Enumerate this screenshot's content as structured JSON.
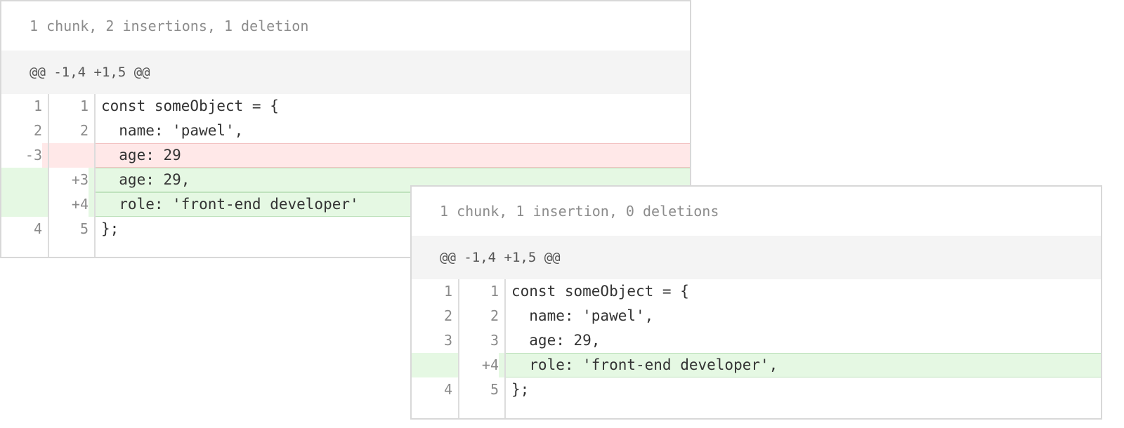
{
  "panels": [
    {
      "summary": "1 chunk, 2 insertions, 1 deletion",
      "hunk_header": "@@ -1,4 +1,5 @@",
      "lines": [
        {
          "type": "ctx",
          "old": "1",
          "new": "1",
          "code": "const someObject = {"
        },
        {
          "type": "ctx",
          "old": "2",
          "new": "2",
          "code": "  name: 'pawel',"
        },
        {
          "type": "del",
          "old": "-3",
          "new": "",
          "code": "  age: 29"
        },
        {
          "type": "add",
          "old": "",
          "new": "+3",
          "code": "  age: 29,"
        },
        {
          "type": "add",
          "old": "",
          "new": "+4",
          "code": "  role: 'front-end developer'"
        },
        {
          "type": "ctx",
          "old": "4",
          "new": "5",
          "code": "};"
        }
      ]
    },
    {
      "summary": "1 chunk, 1 insertion, 0 deletions",
      "hunk_header": "@@ -1,4 +1,5 @@",
      "lines": [
        {
          "type": "ctx",
          "old": "1",
          "new": "1",
          "code": "const someObject = {"
        },
        {
          "type": "ctx",
          "old": "2",
          "new": "2",
          "code": "  name: 'pawel',"
        },
        {
          "type": "ctx",
          "old": "3",
          "new": "3",
          "code": "  age: 29,"
        },
        {
          "type": "add",
          "old": "",
          "new": "+4",
          "code": "  role: 'front-end developer',"
        },
        {
          "type": "ctx",
          "old": "4",
          "new": "5",
          "code": "};"
        }
      ]
    }
  ]
}
